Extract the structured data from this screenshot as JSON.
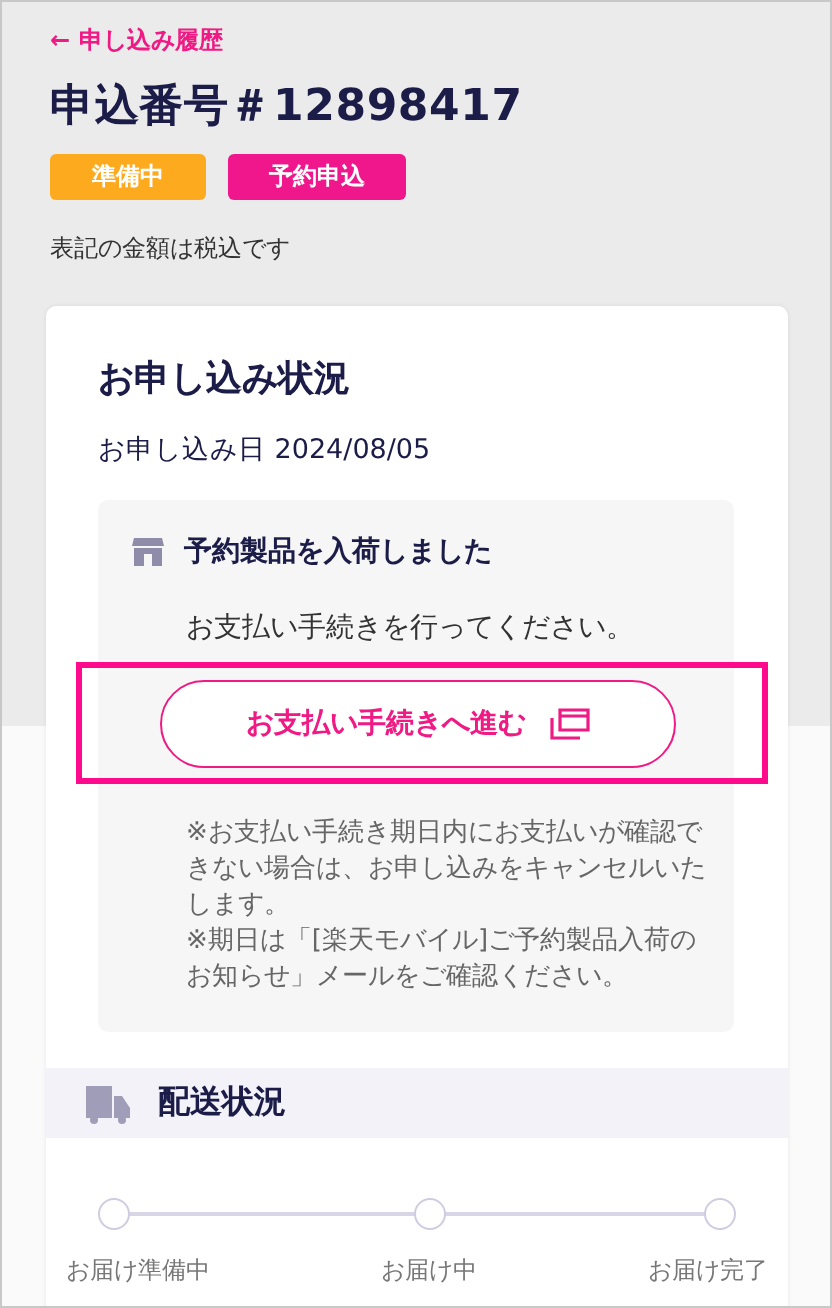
{
  "back_link": {
    "arrow": "←",
    "label": "申し込み履歴"
  },
  "title": "申込番号＃12898417",
  "tags": [
    {
      "label": "準備中",
      "color": "#fdaa1e"
    },
    {
      "label": "予約申込",
      "color": "#f0168c"
    }
  ],
  "tax_note": "表記の金額は税込です",
  "status_card": {
    "title": "お申し込み状況",
    "date": "お申し込み日 2024/08/05",
    "notice": {
      "heading": "予約製品を入荷しました",
      "body": "お支払い手続きを行ってください。",
      "button": "お支払い手続きへ進む",
      "notes": [
        "※お支払い手続き期日内にお支払いが確認できない場合は、お申し込みをキャンセルいたします。",
        "※期日は「[楽天モバイル]ご予約製品入荷のお知らせ」メールをご確認ください。"
      ]
    }
  },
  "delivery": {
    "title": "配送状況",
    "steps": [
      {
        "label": "お届け準備中",
        "done": false
      },
      {
        "label": "お届け中",
        "done": false
      },
      {
        "label": "お届け完了",
        "done": false
      }
    ]
  }
}
